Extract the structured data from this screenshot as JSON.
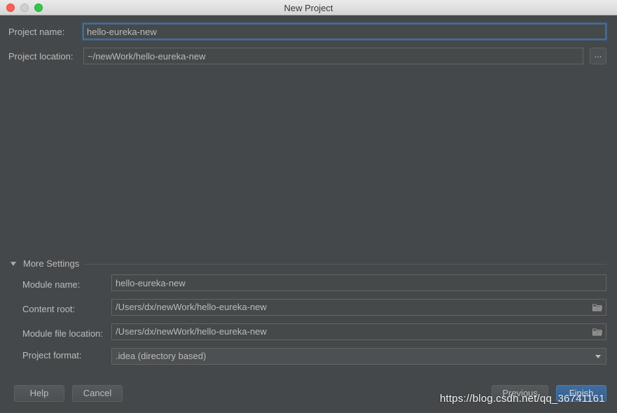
{
  "window": {
    "title": "New Project"
  },
  "project": {
    "name_label": "Project name:",
    "name_value": "hello-eureka-new",
    "location_label": "Project location:",
    "location_value": "~/newWork/hello-eureka-new",
    "browse_label": "..."
  },
  "more_settings": {
    "header": "More Settings",
    "module_name_label": "Module name:",
    "module_name_value": "hello-eureka-new",
    "content_root_label": "Content root:",
    "content_root_value": "/Users/dx/newWork/hello-eureka-new",
    "module_file_label": "Module file location:",
    "module_file_value": "/Users/dx/newWork/hello-eureka-new",
    "format_label": "Project format:",
    "format_value": ".idea (directory based)"
  },
  "buttons": {
    "help": "Help",
    "cancel": "Cancel",
    "previous": "Previous",
    "finish": "Finish"
  },
  "watermark": "https://blog.csdn.net/qq_36741161",
  "icons": {
    "browse_folder": "folder-icon",
    "collapse": "triangle-down-icon",
    "dropdown": "chevron-down-icon"
  },
  "colors": {
    "background": "#45484a",
    "focus_border": "#466d94",
    "default_button": "#365f8c"
  }
}
